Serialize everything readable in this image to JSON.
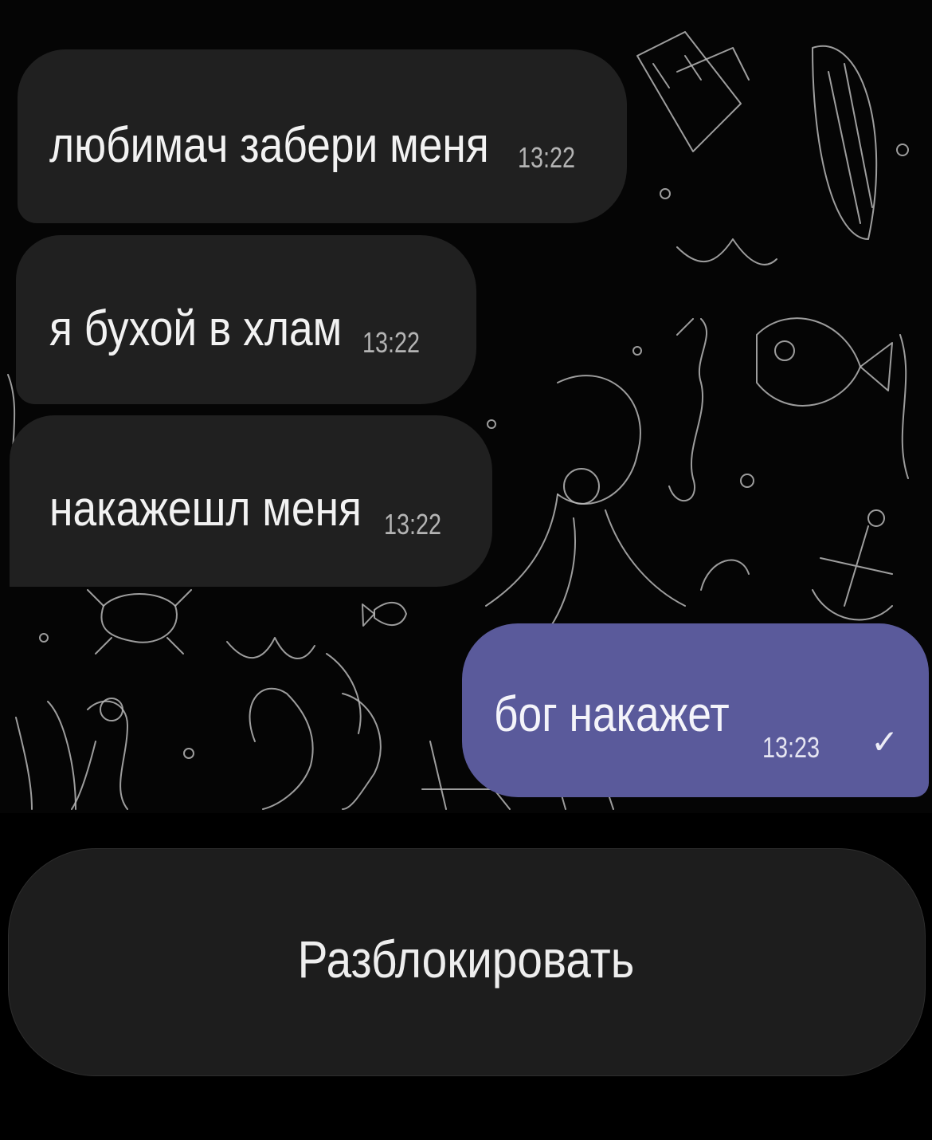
{
  "messages": [
    {
      "direction": "incoming",
      "text": "любимач забери меня",
      "time": "13:22"
    },
    {
      "direction": "incoming",
      "text": "я бухой в хлам",
      "time": "13:22"
    },
    {
      "direction": "incoming",
      "text": "накажешл меня",
      "time": "13:22"
    },
    {
      "direction": "outgoing",
      "text": "бог накажет",
      "time": "13:23",
      "status_icon": "✓",
      "status": "sent"
    }
  ],
  "actions": {
    "unblock_label": "Разблокировать"
  },
  "theme": {
    "background": "#000000",
    "incoming_bubble": "#202020",
    "outgoing_bubble": "#5a5a9b",
    "text": "#f2f2f2"
  },
  "icons": {
    "wallpaper": "sea-doodle-pattern",
    "status": "checkmark-icon"
  }
}
